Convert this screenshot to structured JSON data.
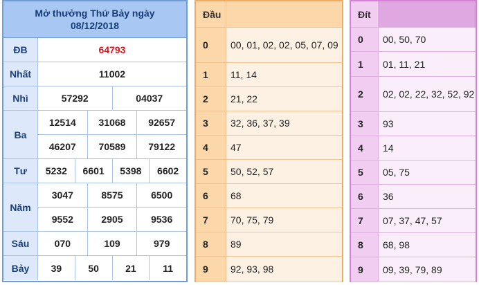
{
  "results": {
    "title_line1": "Mở thưởng Thứ Bảy ngày",
    "title_line2": "08/12/2018",
    "prizes": [
      {
        "label": "ĐB",
        "lines": [
          [
            "64793"
          ]
        ]
      },
      {
        "label": "Nhất",
        "lines": [
          [
            "11002"
          ]
        ]
      },
      {
        "label": "Nhì",
        "lines": [
          [
            "57292",
            "04037"
          ]
        ]
      },
      {
        "label": "Ba",
        "lines": [
          [
            "12514",
            "31068",
            "92657"
          ],
          [
            "46207",
            "70589",
            "79122"
          ]
        ]
      },
      {
        "label": "Tư",
        "lines": [
          [
            "5232",
            "6601",
            "5398",
            "6602"
          ]
        ]
      },
      {
        "label": "Năm",
        "lines": [
          [
            "3047",
            "8575",
            "6500"
          ],
          [
            "9552",
            "2905",
            "9536"
          ]
        ]
      },
      {
        "label": "Sáu",
        "lines": [
          [
            "070",
            "109",
            "979"
          ]
        ]
      },
      {
        "label": "Bảy",
        "lines": [
          [
            "39",
            "50",
            "21",
            "11"
          ]
        ]
      }
    ],
    "special_color": "#e0141b"
  },
  "dau": {
    "header_key": "Đầu",
    "header_vals": "",
    "rows": [
      {
        "key": "0",
        "vals": "00, 01, 02, 02, 05, 07, 09"
      },
      {
        "key": "1",
        "vals": "11, 14"
      },
      {
        "key": "2",
        "vals": "21, 22"
      },
      {
        "key": "3",
        "vals": "32, 36, 37, 39"
      },
      {
        "key": "4",
        "vals": "47"
      },
      {
        "key": "5",
        "vals": "50, 52, 57"
      },
      {
        "key": "6",
        "vals": "68"
      },
      {
        "key": "7",
        "vals": "70, 75, 79"
      },
      {
        "key": "8",
        "vals": "89"
      },
      {
        "key": "9",
        "vals": "92, 93, 98"
      }
    ]
  },
  "dit": {
    "header_key": "Đít",
    "header_vals": "",
    "rows": [
      {
        "key": "0",
        "vals": "00, 50, 70"
      },
      {
        "key": "1",
        "vals": "01, 11, 21"
      },
      {
        "key": "2",
        "vals": "02, 02, 22, 32, 52, 92"
      },
      {
        "key": "3",
        "vals": "93"
      },
      {
        "key": "4",
        "vals": "14"
      },
      {
        "key": "5",
        "vals": "05, 75"
      },
      {
        "key": "6",
        "vals": "36"
      },
      {
        "key": "7",
        "vals": "07, 37, 47, 57"
      },
      {
        "key": "8",
        "vals": "68, 98"
      },
      {
        "key": "9",
        "vals": "09, 39, 79, 89"
      }
    ]
  }
}
